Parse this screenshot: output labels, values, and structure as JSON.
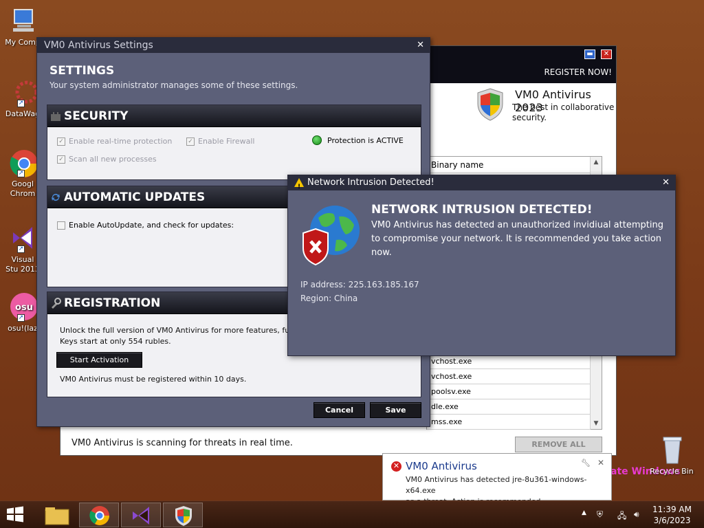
{
  "desktop": {
    "icons": [
      {
        "label": "My Comp",
        "name": "desktop-icon-my-computer"
      },
      {
        "label": "DataWag",
        "name": "desktop-icon-datawag"
      },
      {
        "label": "Googl Chrom",
        "name": "desktop-icon-google-chrome"
      },
      {
        "label": "Visual Stu 2013",
        "name": "desktop-icon-visual-studio"
      },
      {
        "label": "osu!(laz",
        "name": "desktop-icon-osu"
      }
    ],
    "recycle_bin_label": "Recycle Bin",
    "activate_windows": "ate Windows"
  },
  "main_window": {
    "register_label": "REGISTER NOW!",
    "brand_name": "VM0 Antivirus 2023",
    "brand_tagline": "The best in collaborative security.",
    "table_header": "Binary name",
    "processes": [
      "vchost.exe",
      "vchost.exe",
      "poolsv.exe",
      "dle.exe",
      "mss.exe"
    ],
    "status_text": "VM0 Antivirus is scanning for threats in real time.",
    "remove_all_label": "REMOVE ALL THREATS"
  },
  "settings": {
    "title": "VM0 Antivirus Settings",
    "heading": "SETTINGS",
    "subheading": "Your system administrator manages some of these settings.",
    "security": {
      "title": "SECURITY",
      "realtime": "Enable real-time protection",
      "firewall": "Enable Firewall",
      "scan_all": "Scan all new processes",
      "status": "Protection is ACTIVE"
    },
    "updates": {
      "title": "AUTOMATIC UPDATES",
      "autoupdate": "Enable AutoUpdate, and check for updates:"
    },
    "registration": {
      "title": "REGISTRATION",
      "line1": "Unlock the full version of VM0 Antivirus for more features, full",
      "line2": "Keys start at only 554 rubles.",
      "activation_button": "Start Activation",
      "deadline": "VM0 Antivirus must be registered within 10 days."
    },
    "cancel_label": "Cancel",
    "save_label": "Save"
  },
  "intrusion": {
    "window_title": "Network Intrusion Detected!",
    "heading": "NETWORK INTRUSION DETECTED!",
    "message": "VM0 Antivirus has detected an unauthorized invidiual attempting to compromise your network. It is recommended you take action now.",
    "ip": "IP address: 225.163.185.167",
    "region": "Region: China"
  },
  "toast": {
    "title": "VM0 Antivirus",
    "line1": "VM0 Antivirus has detected jre-8u361-windows-x64.exe",
    "line2": "as a threat. Action is recommended."
  },
  "taskbar": {
    "time": "11:39 AM",
    "date": "3/6/2023",
    "items": [
      "file-explorer",
      "google-chrome",
      "visual-studio",
      "vm0-antivirus"
    ]
  },
  "colors": {
    "dialog_bg": "#5c6079",
    "titlebar_bg": "#2a2c3c",
    "accent_green": "#1a8a1a",
    "alert_red": "#d32020"
  }
}
